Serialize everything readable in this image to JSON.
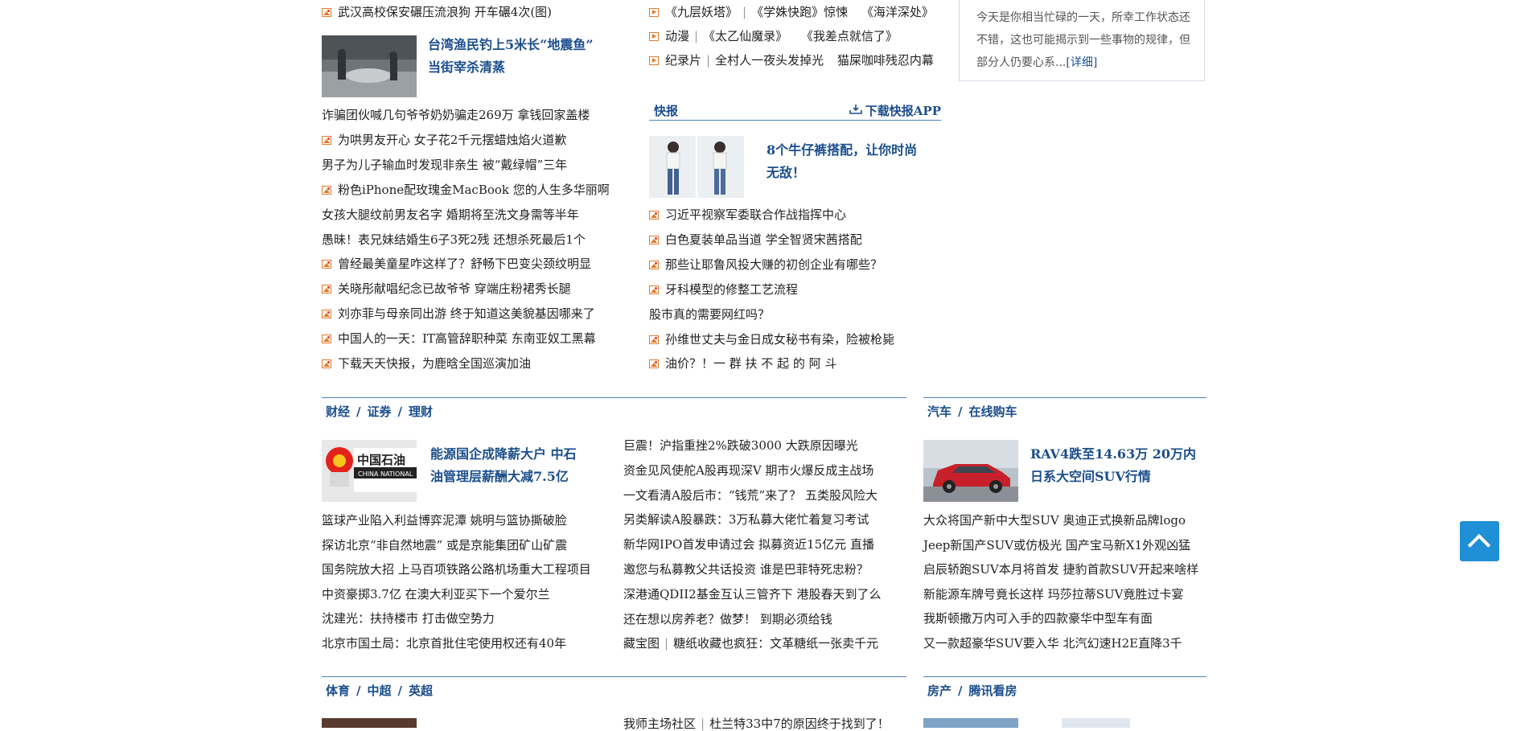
{
  "left_col": {
    "top_line": "武汉高校保安碾压流浪狗 开车碾4次(图)",
    "feature_title_1": "台湾渔民钓上5米长“地震鱼”",
    "feature_title_2": "当街宰杀清蒸",
    "items": [
      {
        "text": "诈骗团伙喊几句爷爷奶奶骗走269万 拿钱回家盖楼",
        "icon": "none"
      },
      {
        "text": "为哄男友开心 女子花2千元摆蜡烛焰火道歉",
        "icon": "photo-icon"
      },
      {
        "text": "男子为儿子输血时发现非亲生 被“戴绿帽”三年",
        "icon": "none"
      },
      {
        "text": "粉色iPhone配玫瑰金MacBook 您的人生多华丽啊",
        "icon": "photo-icon"
      },
      {
        "text": "女孩大腿纹前男友名字 婚期将至洗文身需等半年",
        "icon": "none"
      },
      {
        "text": "愚昧！表兄妹结婚生6子3死2残 还想杀死最后1个",
        "icon": "none"
      },
      {
        "text": "曾经最美童星咋这样了？舒畅下巴变尖颈纹明显",
        "icon": "photo-icon"
      },
      {
        "text": "关晓彤献唱纪念已故爷爷 穿端庄粉裙秀长腿",
        "icon": "photo-icon"
      },
      {
        "text": "刘亦菲与母亲同出游 终于知道这美貌基因哪来了",
        "icon": "photo-icon"
      },
      {
        "text": "中国人的一天：IT高管辞职种菜 东南亚奴工黑幕",
        "icon": "photo-icon"
      },
      {
        "text": "下载天天快报，为鹿晗全国巡演加油",
        "icon": "photo-icon"
      }
    ]
  },
  "mid_col": {
    "video_items": [
      {
        "a": "《九层妖塔》",
        "b": "《学姝快跑》惊悚",
        "c": "《海洋深处》"
      },
      {
        "a": "动漫",
        "b": "《太乙仙魔录》",
        "c": "《我差点就信了》"
      },
      {
        "a": "纪录片",
        "b": "全村人一夜头发掉光",
        "c": "猫屎咖啡残忍内幕"
      }
    ],
    "kuaibao_label": "快报",
    "download_label": "下载快报APP",
    "feature_title_1": "8个牛仔裤搭配，让你时尚",
    "feature_title_2": "无敌！",
    "items": [
      {
        "text": "习近平视察军委联合作战指挥中心",
        "icon": "photo-icon"
      },
      {
        "text": "白色夏装单品当道 学全智贤宋茜搭配",
        "icon": "photo-icon"
      },
      {
        "text": "那些让耶鲁风投大赚的初创企业有哪些？",
        "icon": "photo-icon"
      },
      {
        "text": "牙科模型的修整工艺流程",
        "icon": "photo-icon"
      },
      {
        "text": "股市真的需要网红吗？",
        "icon": "none"
      },
      {
        "text": "孙维世丈夫与金日成女秘书有染，险被枪毙",
        "icon": "photo-icon"
      },
      {
        "text": "油价？！一 群 扶 不 起 的 阿 斗",
        "icon": "photo-icon"
      }
    ]
  },
  "horoscope": {
    "text": "今天是你相当忙碌的一天，所幸工作状态还不错，这也可能揭示到一些事物的规律，但部分人仍要心系...",
    "detail": "[详细]"
  },
  "finance": {
    "tabs": [
      "财经",
      "证券",
      "理财"
    ],
    "feature_title_1": "能源国企成降薪大户 中石",
    "feature_title_2": "油管理层薪酬大减7.5亿",
    "logo_text": "中国石油",
    "logo_sub": "CHINA NATIONAL",
    "left_items": [
      "篮球产业陷入利益博弈泥潭 姚明与篮协撕破脸",
      "探访北京“非自然地震” 或是京能集团矿山矿震",
      "国务院放大招 上马百项铁路公路机场重大工程项目",
      "中资豪掷3.7亿 在澳大利亚买下一个爱尔兰",
      "沈建光：扶持楼市 打击做空势力",
      "北京市国土局：北京首批住宅使用权还有40年"
    ],
    "right_items": [
      {
        "a": "巨震！沪指重挫2%跌破3000 大跌原因曝光",
        "b": ""
      },
      {
        "a": "资金见风使舵A股再现深V 期市火爆反成主战场",
        "b": ""
      },
      {
        "a": "一文看清A股后市：“钱荒”来了？ 五类股风险大",
        "b": ""
      },
      {
        "a": "另类解读A股暴跌：3万私募大佬忙着复习考试",
        "b": ""
      },
      {
        "a": "新华网IPO首发申请过会 拟募资近15亿元 直播",
        "b": ""
      },
      {
        "a": "邀您与私募教父共话投资 谁是巴菲特死忠粉？",
        "b": ""
      },
      {
        "a": "深港通QDII2基金互认三管齐下 港股春天到了么",
        "b": ""
      },
      {
        "a": "还在想以房养老？做梦！ 到期必须给钱",
        "b": ""
      },
      {
        "a": "藏宝图",
        "b": "糖纸收藏也疯狂：文革糖纸一张卖千元"
      }
    ]
  },
  "auto": {
    "tabs": [
      "汽车",
      "在线购车"
    ],
    "feature_title_1": "RAV4跌至14.63万 20万内",
    "feature_title_2": "日系大空间SUV行情",
    "items": [
      "大众将国产新中大型SUV 奥迪正式换新品牌logo",
      "Jeep新国产SUV或仿极光 国产宝马新X1外观凶猛",
      "启辰轿跑SUV本月将首发 捷豹首款SUV开起来啥样",
      "新能源车牌号竟长这样 玛莎拉蒂SUV竟胜过卡宴",
      "我斯顿撒万内可入手的四款豪华中型车有面",
      "又一款超豪华SUV要入华 北汽幻速H2E直降3千"
    ]
  },
  "sports": {
    "tabs": [
      "体育",
      "中超",
      "英超"
    ],
    "partial_line_a": "我师主场社区",
    "partial_line_b": "杜兰特33中7的原因终于找到了！"
  },
  "house": {
    "tabs": [
      "房产",
      "腾讯看房"
    ]
  }
}
